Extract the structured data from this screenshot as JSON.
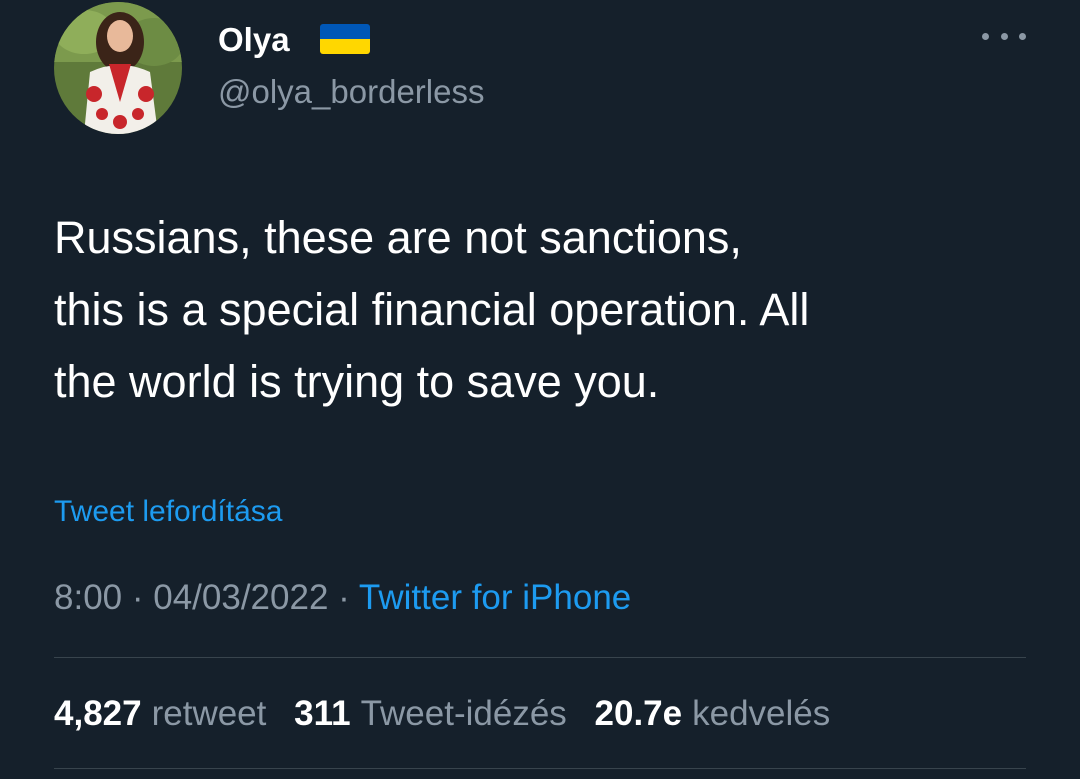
{
  "author": {
    "display_name": "Olya",
    "handle": "@olya_borderless",
    "flag_icon": "ukraine-flag-icon",
    "flag_colors": {
      "top": "#0057b7",
      "bottom": "#ffd700"
    }
  },
  "tweet": {
    "text_lines": [
      "Russians, these are not sanctions,",
      "this is a special financial operation. All",
      "the world is trying to save you."
    ],
    "translate_label": "Tweet lefordítása",
    "time": "8:00",
    "date": "04/03/2022",
    "separator": "·",
    "source": "Twitter for iPhone"
  },
  "stats": {
    "retweets": {
      "count": "4,827",
      "label": "retweet"
    },
    "quotes": {
      "count": "311",
      "label": "Tweet-idézés"
    },
    "likes": {
      "count": "20.7e",
      "label": "kedvelés"
    }
  },
  "colors": {
    "background": "#15202b",
    "primary_text": "#ffffff",
    "secondary_text": "#8b98a5",
    "link": "#1d9bf0",
    "divider": "#38444d"
  },
  "icons": {
    "more": "more-dots-icon"
  }
}
